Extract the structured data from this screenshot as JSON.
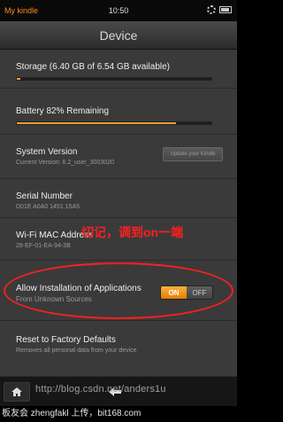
{
  "status_bar": {
    "brand": "My kindle",
    "time": "10:50",
    "icons": [
      "gear-icon",
      "battery-icon"
    ]
  },
  "header": {
    "title": "Device"
  },
  "storage": {
    "title": "Storage (6.40 GB of 6.54 GB available)",
    "used_fraction": 0.02
  },
  "battery": {
    "title": "Battery 82% Remaining",
    "level_fraction": 0.82
  },
  "system_version": {
    "title": "System Version",
    "subtitle": "Current Version: 6.2_user_3003020",
    "update_button": "Update your Kindle"
  },
  "serial": {
    "title": "Serial Number",
    "value": "D01E A0A0 1451 15A5"
  },
  "wifi": {
    "title": "Wi-Fi MAC Address",
    "value": "28-EF-01-EA-94-3B"
  },
  "annotation": "切记，调到on一端",
  "install_apps": {
    "title": "Allow Installation of Applications",
    "subtitle": "From Unknown Sources",
    "toggle_on": "ON",
    "toggle_off": "OFF",
    "state": "on"
  },
  "reset": {
    "title": "Reset to Factory Defaults",
    "subtitle": "Removes all personal data from your device"
  },
  "nav": {
    "home_icon": "home-icon",
    "back_icon": "back-arrow-icon"
  },
  "watermark": "http://blog.csdn.net/anders1u",
  "footer": "板友会 zhengfakl 上传，bit168.com",
  "colors": {
    "accent": "#e88a10",
    "annotation": "#ff1f1f",
    "background": "#3a3a3a"
  }
}
